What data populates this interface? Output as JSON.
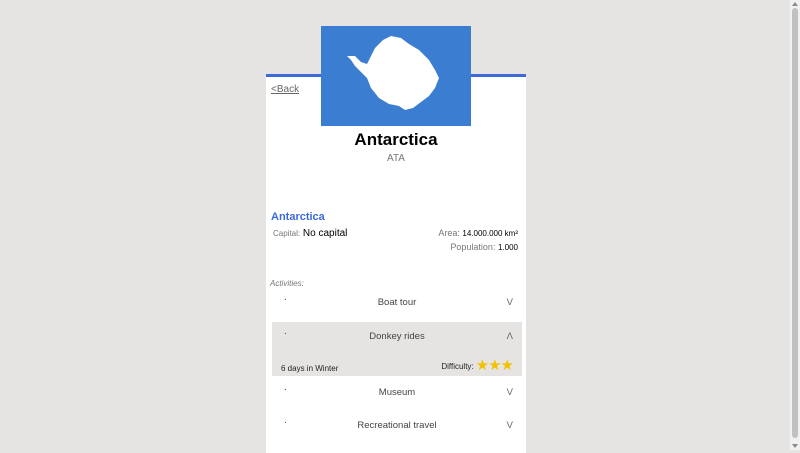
{
  "nav": {
    "back_label": "<Back"
  },
  "country": {
    "name": "Antarctica",
    "code": "ATA",
    "section_title": "Antarctica",
    "capital_label": "Capital:",
    "capital_value": "No capital",
    "area_label": "Area:",
    "area_value": "14.000.000 km²",
    "population_label": "Population:",
    "population_value": "1.000",
    "flag_icon": "antarctica-flag-icon",
    "flag_color": "#3a7dd1"
  },
  "activities": {
    "label": "Activities:",
    "items": [
      {
        "bullet": ".",
        "name": "Boat tour",
        "chevron": "V"
      },
      {
        "bullet": ".",
        "name": "Donkey rides",
        "chevron": "Λ",
        "details": "6 days in Winter",
        "difficulty_label": "Difficulty:",
        "difficulty_stars": "★★★",
        "difficulty_level": 3
      },
      {
        "bullet": ".",
        "name": "Museum",
        "chevron": "V"
      },
      {
        "bullet": ".",
        "name": "Recreational travel",
        "chevron": "V"
      }
    ]
  },
  "colors": {
    "accent": "#3b6ad8",
    "background": "#e6e4e3",
    "star": "#f2c200"
  }
}
